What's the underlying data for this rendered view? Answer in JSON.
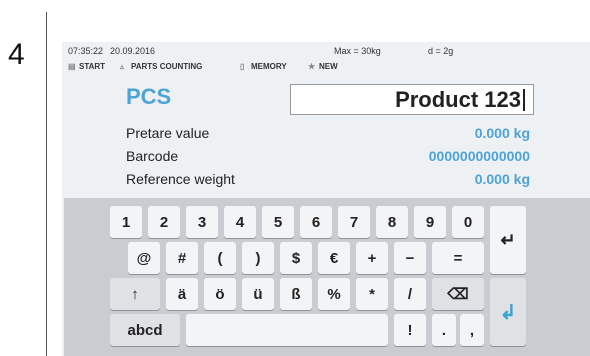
{
  "step_number": "4",
  "status": {
    "time": "07:35:22",
    "date": "20.09.2016",
    "max": "Max = 30kg",
    "d": "d = 2g"
  },
  "menu": [
    {
      "label": "START",
      "icon": "scale-icon"
    },
    {
      "label": "PARTS COUNTING",
      "icon": "pieces-icon"
    },
    {
      "label": "MEMORY",
      "icon": "memory-icon"
    },
    {
      "label": "NEW",
      "icon": "star-icon"
    }
  ],
  "mode_label": "PCS",
  "product_name": "Product 123",
  "fields": [
    {
      "label": "Pretare value",
      "value": "0.000",
      "unit": "kg"
    },
    {
      "label": "Barcode",
      "value": "0000000000000",
      "unit": ""
    },
    {
      "label": "Reference weight",
      "value": "0.000",
      "unit": "kg"
    }
  ],
  "keyboard": {
    "row1": [
      "1",
      "2",
      "3",
      "4",
      "5",
      "6",
      "7",
      "8",
      "9",
      "0"
    ],
    "row2": [
      "@",
      "#",
      "(",
      ")",
      "$",
      "€",
      "+",
      "−",
      "="
    ],
    "row3": [
      "↑",
      "ä",
      "ö",
      "ü",
      "ß",
      "%",
      "*",
      "/"
    ],
    "backspace": "⌫",
    "row4_left": "abcd",
    "row4_right": [
      "!",
      ".",
      ","
    ],
    "return_key": "↵",
    "enter_key": "↲"
  }
}
